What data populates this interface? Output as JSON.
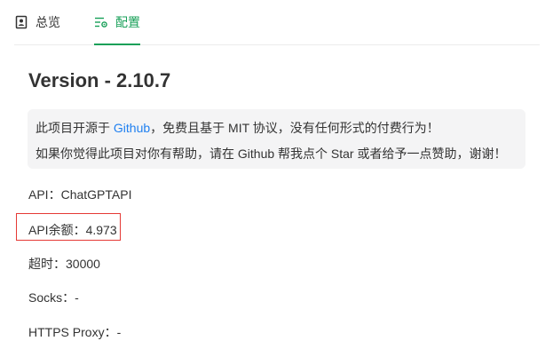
{
  "tabs": [
    {
      "label": "总览",
      "icon": "document-user-icon",
      "active": false
    },
    {
      "label": "配置",
      "icon": "settings-list-icon",
      "active": true
    }
  ],
  "colors": {
    "accent": "#18a058",
    "link": "#2080f0",
    "highlight_border": "#e53935",
    "notice_bg": "#f4f4f5"
  },
  "version_title": "Version - 2.10.7",
  "notice": {
    "line1_prefix": "此项目开源于 ",
    "line1_link": "Github",
    "line1_suffix": "，免费且基于 MIT 协议，没有任何形式的付费行为！",
    "line2": "如果你觉得此项目对你有帮助，请在 Github 帮我点个 Star 或者给予一点赞助，谢谢！"
  },
  "info": {
    "api_label": "API：",
    "api_value": "ChatGPTAPI",
    "balance_label": "API余额：",
    "balance_value": "4.973",
    "timeout_label": "超时：",
    "timeout_value": "30000",
    "socks_label": "Socks：",
    "socks_value": "-",
    "proxy_label": "HTTPS Proxy：",
    "proxy_value": "-"
  }
}
